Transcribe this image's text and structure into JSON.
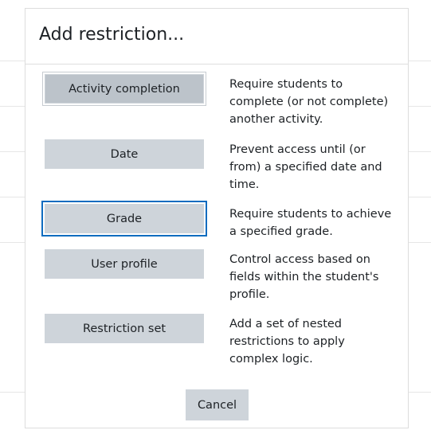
{
  "dialog": {
    "title": "Add restriction...",
    "options": [
      {
        "label": "Activity completion",
        "description": "Require students to complete (or not complete) another activity."
      },
      {
        "label": "Date",
        "description": "Prevent access until (or from) a specified date and time."
      },
      {
        "label": "Grade",
        "description": "Require students to achieve a specified grade."
      },
      {
        "label": "User profile",
        "description": "Control access based on fields within the student's profile."
      },
      {
        "label": "Restriction set",
        "description": "Add a set of nested restrictions to apply complex logic."
      }
    ],
    "cancel_label": "Cancel"
  },
  "colors": {
    "button_bg": "#ced4da",
    "focus_ring": "#0f6cbf",
    "text": "#1d2125"
  }
}
